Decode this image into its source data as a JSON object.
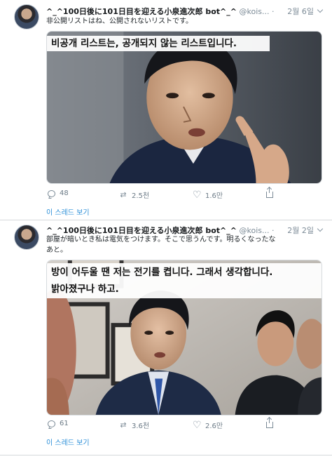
{
  "tweets": [
    {
      "display_name": "^_^100日後に101日目を迎える小泉進次郎 bot^_^",
      "handle": "@kois...",
      "date": "2월 6일",
      "text": "非公開リストはね、公開されないリストです。",
      "caption_lines": [
        "비공개 리스트는, 공개되지 않는 리스트입니다."
      ],
      "replies": "48",
      "retweets": "2.5천",
      "likes": "1.6만",
      "thread_link": "이 스레드 보기"
    },
    {
      "display_name": "^_^100日後に101日目を迎える小泉進次郎 bot^_^",
      "handle": "@kois...",
      "date": "2월 2일",
      "text_lines": [
        "部屋が暗いとき私は電気をつけます。そこで思うんです。明るくなったな",
        "あと。"
      ],
      "caption_lines": [
        "방이 어두울 땐 저는 전기를 켭니다. 그래서 생각합니다.",
        "밝아졌구나 하고."
      ],
      "replies": "61",
      "retweets": "3.6천",
      "likes": "2.6만",
      "thread_link": "이 스레드 보기"
    }
  ],
  "colors": {
    "link": "#2b8fd8",
    "muted": "#7b8a96",
    "border": "#d4d8db"
  },
  "icons": [
    "reply-icon",
    "retweet-icon",
    "like-icon",
    "share-icon",
    "chevron-down-icon"
  ]
}
